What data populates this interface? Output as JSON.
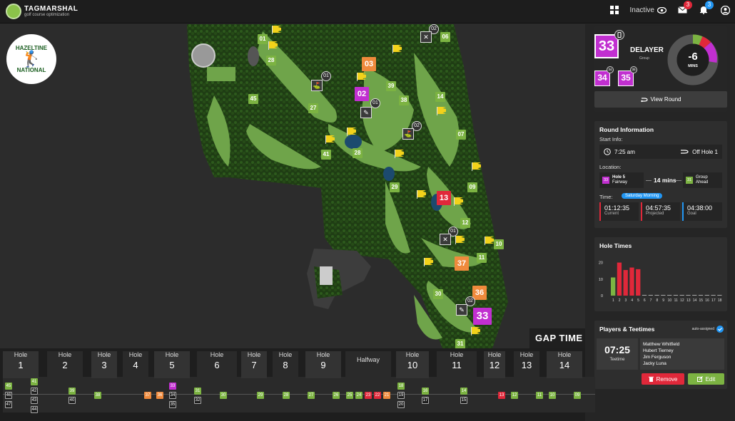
{
  "app": {
    "logo_main": "TAGMARSHAL",
    "logo_sub": "golf course optimization",
    "status": "Inactive",
    "mail_count": "3",
    "alert_count": "3"
  },
  "course": {
    "logo_line1": "HAZELTINE",
    "logo_line2": "NATIONAL",
    "gap_label": "GAP TIME MO"
  },
  "map_markers": {
    "green": [
      "01",
      "06",
      "28",
      "45",
      "27",
      "41",
      "28",
      "39",
      "38",
      "14",
      "07",
      "29",
      "09",
      "12",
      "10",
      "11",
      "30",
      "31"
    ],
    "orange": [
      "03",
      "37",
      "36"
    ],
    "purple": [
      "02",
      "33"
    ],
    "red": [
      "13"
    ],
    "circles": [
      "02",
      "01",
      "01",
      "02",
      "01",
      "02"
    ]
  },
  "group": {
    "number": "33",
    "status": "DELAYER",
    "status_sub": "Group",
    "ahead": "34",
    "behind": "35",
    "ahead_badge": "34",
    "behind_badge": "35",
    "donut_value": "-6",
    "donut_unit": "MINS",
    "view_round": "View Round"
  },
  "round_info": {
    "title": "Round Information",
    "start_label": "Start Info:",
    "start_time": "7:25 am",
    "start_hole": "Off Hole 1",
    "location_label": "Location:",
    "loc_group": "33",
    "loc_hole": "Hole 5",
    "loc_where": "Fairway",
    "gap": "14 mins",
    "ahead_group": "31",
    "ahead_label1": "Group",
    "ahead_label2": "Ahead",
    "time_label": "Time:",
    "time_tag": "Saturday Morning",
    "current": "01:12:35",
    "current_label": "Current",
    "projected": "04:57:35",
    "projected_label": "Projected",
    "goal": "04:38:00",
    "goal_label": "Goal"
  },
  "hole_times": {
    "title": "Hole Times",
    "y_ticks": [
      "20",
      "10",
      "0"
    ],
    "categories": [
      "1",
      "2",
      "3",
      "4",
      "5",
      "6",
      "7",
      "8",
      "9",
      "10",
      "11",
      "12",
      "13",
      "14",
      "15",
      "16",
      "17",
      "18"
    ]
  },
  "players": {
    "title": "Players & Teetimes",
    "auto": "auto-assigned",
    "teetime": "07:25",
    "teetime_label": "Teetime",
    "names": [
      "Matthew Whitfield",
      "Hubert Tierney",
      "Jim Ferguson",
      "Jacky Luna"
    ],
    "remove": "Remove",
    "edit": "Edit"
  },
  "bottom": {
    "hole_label": "Hole",
    "halfway": "Halfway",
    "holes": [
      "1",
      "2",
      "3",
      "4",
      "5",
      "6",
      "7",
      "8",
      "9",
      "10",
      "11",
      "12",
      "13",
      "14"
    ]
  },
  "chart_data": {
    "type": "bar",
    "title": "Hole Times",
    "categories": [
      "1",
      "2",
      "3",
      "4",
      "5",
      "6",
      "7",
      "8",
      "9",
      "10",
      "11",
      "12",
      "13",
      "14",
      "15",
      "16",
      "17",
      "18"
    ],
    "series": [
      {
        "values": [
          11,
          0,
          0,
          0,
          0,
          0,
          0,
          0,
          0,
          0,
          0,
          0,
          0,
          0,
          0,
          0,
          0,
          0
        ],
        "color": "#7cb342"
      },
      {
        "values": [
          0,
          20,
          15.5,
          17,
          16,
          0,
          0,
          0,
          0,
          0,
          0,
          0,
          0,
          0,
          0,
          0,
          0,
          0
        ],
        "color": "#e0283a"
      }
    ],
    "ylim": [
      0,
      25
    ],
    "yticks": [
      0,
      10,
      20
    ]
  },
  "colors": {
    "green": "#7cb342",
    "orange": "#ef8a3c",
    "purple": "#c12fd0",
    "red": "#e0283a",
    "blue": "#2196f3"
  }
}
